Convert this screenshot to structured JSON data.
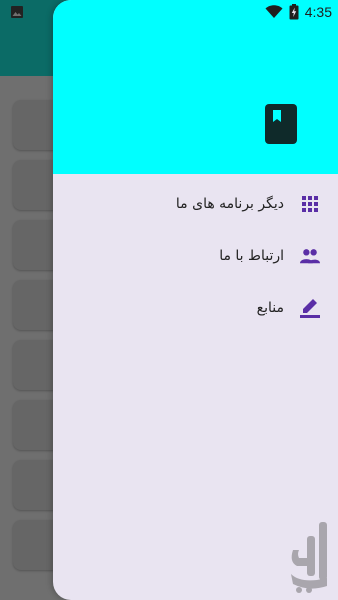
{
  "status_bar": {
    "time": "4:35",
    "icons": [
      "image-notification-icon",
      "wifi-icon",
      "battery-charging-icon"
    ]
  },
  "drawer": {
    "header": {
      "bg_color": "#00ffff",
      "icon": "bookmark-book-icon"
    },
    "accent_color": "#5a2ea6",
    "items": [
      {
        "label": "دیگر برنامه های ما",
        "icon": "apps-grid-icon"
      },
      {
        "label": "ارتباط با ما",
        "icon": "people-icon"
      },
      {
        "label": "منابع",
        "icon": "edit-pen-icon"
      }
    ]
  },
  "background_app": {
    "toolbar_color": "#0b6b66"
  }
}
